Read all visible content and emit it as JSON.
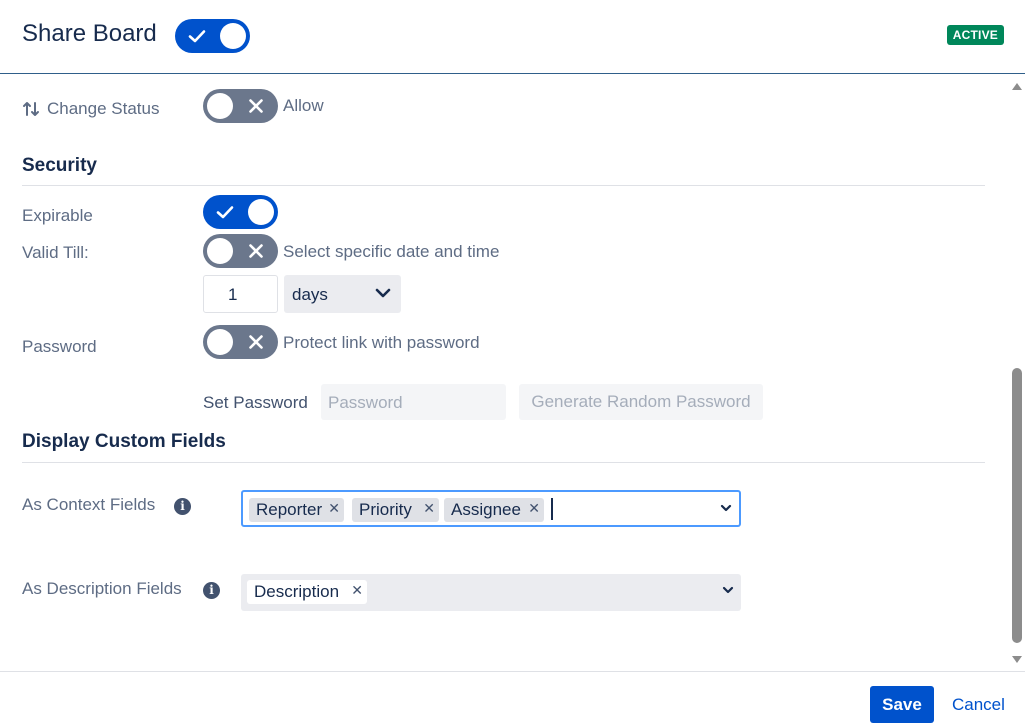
{
  "header": {
    "title": "Share Board",
    "status_badge": "ACTIVE"
  },
  "change_status": {
    "label": "Change Status",
    "toggle_text": "Allow",
    "enabled": false
  },
  "security": {
    "title": "Security",
    "expirable_label": "Expirable",
    "expirable_enabled": true,
    "valid_till_label": "Valid Till:",
    "valid_till_toggle_text": "Select specific date and time",
    "valid_till_enabled": false,
    "duration_value": "1",
    "duration_unit": "days",
    "password_label": "Password",
    "password_toggle_text": "Protect link with password",
    "password_enabled": false,
    "set_password_label": "Set Password",
    "password_placeholder": "Password",
    "generate_button": "Generate Random Password"
  },
  "custom_fields": {
    "title": "Display Custom Fields",
    "context_label": "As Context Fields",
    "context_values": [
      "Reporter",
      "Priority",
      "Assignee"
    ],
    "description_label": "As Description Fields",
    "description_values": [
      "Description"
    ]
  },
  "footer": {
    "save_label": "Save",
    "cancel_label": "Cancel"
  },
  "colors": {
    "accent": "#0052cc",
    "active_badge": "#00875a"
  }
}
